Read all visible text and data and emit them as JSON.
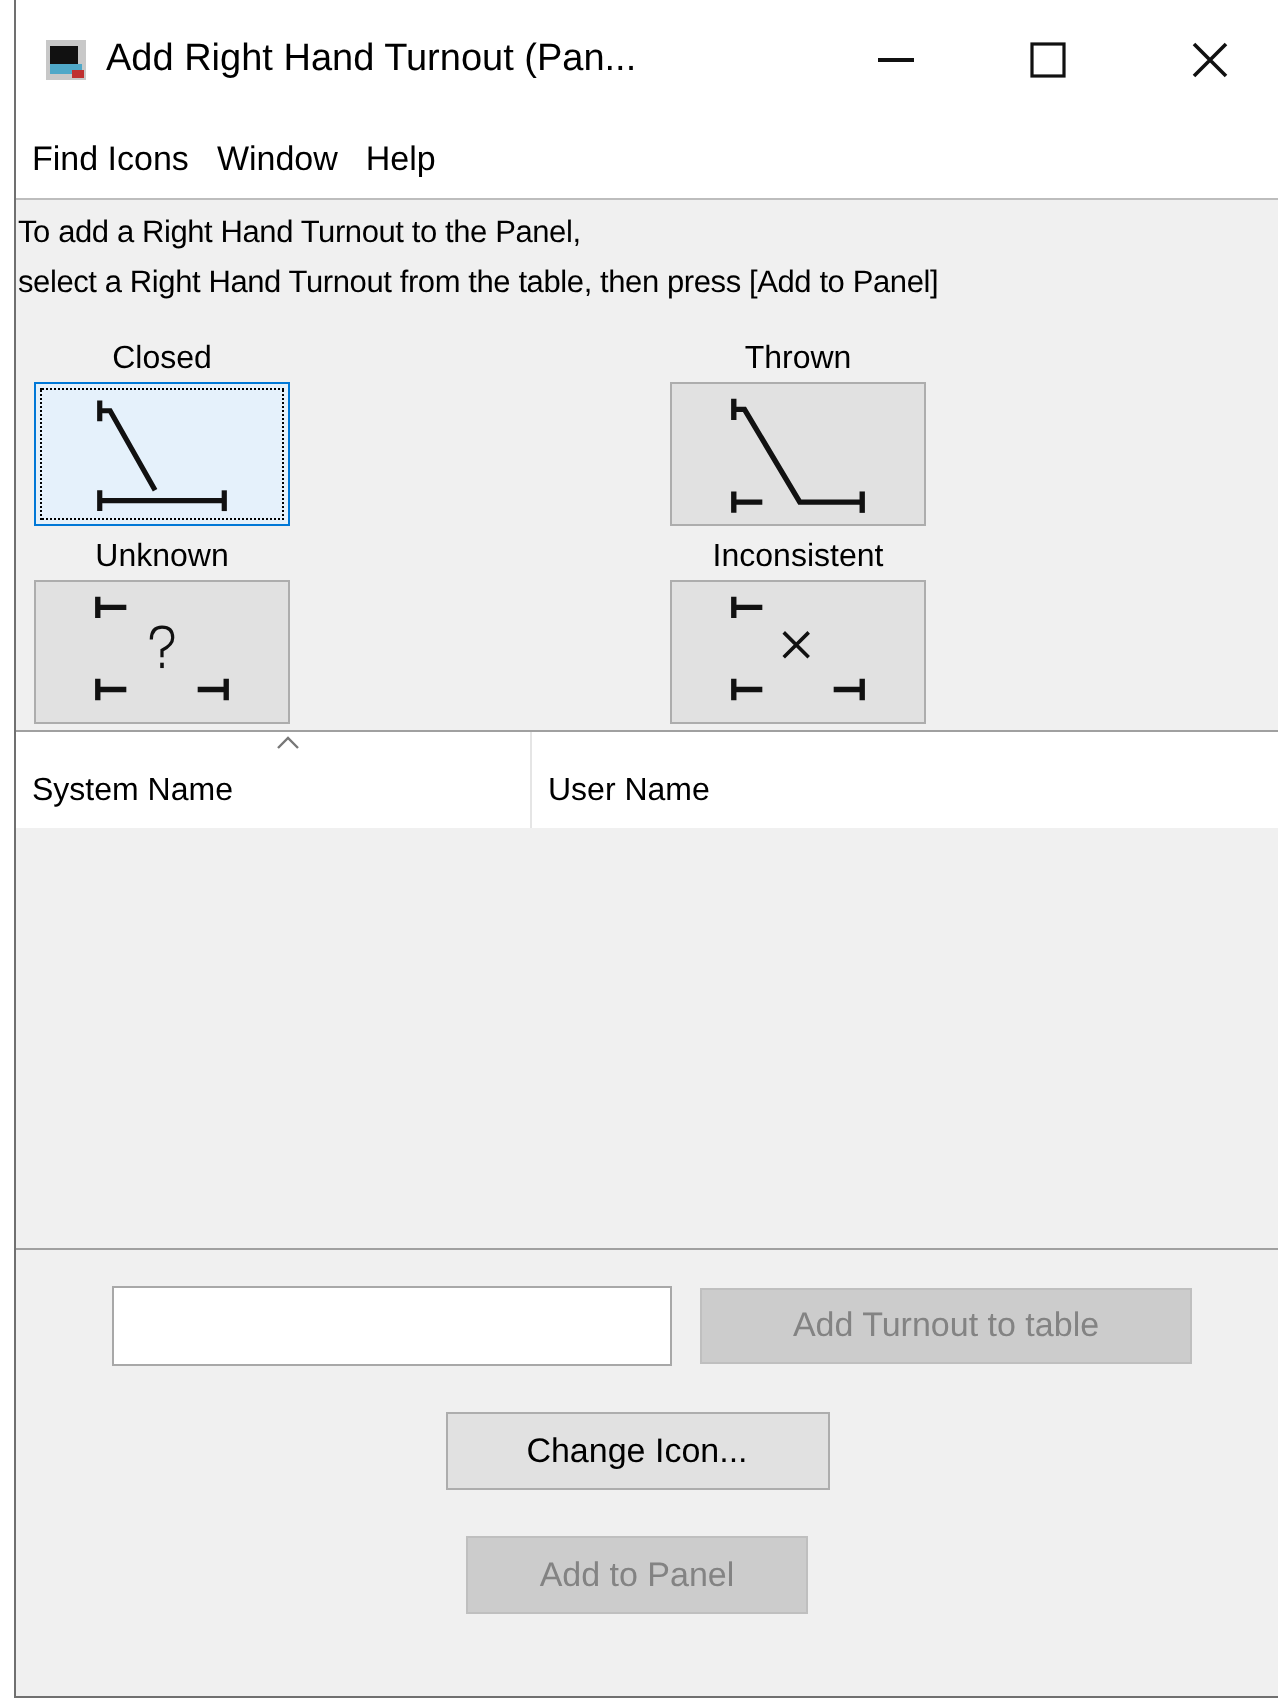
{
  "window": {
    "title": "Add Right Hand Turnout (Pan..."
  },
  "menu": [
    "Find Icons",
    "Window",
    "Help"
  ],
  "instructions": [
    "To add a Right Hand Turnout to the Panel,",
    "select a Right Hand Turnout from the table, then press [Add to Panel]"
  ],
  "icons": [
    {
      "label": "Closed",
      "kind": "closed",
      "selected": true
    },
    {
      "label": "Thrown",
      "kind": "thrown",
      "selected": false
    },
    {
      "label": "Unknown",
      "kind": "unknown",
      "selected": false
    },
    {
      "label": "Inconsistent",
      "kind": "inconsistent",
      "selected": false
    }
  ],
  "table": {
    "columns": [
      {
        "label": "System Name",
        "sorted": true
      },
      {
        "label": "User Name",
        "sorted": false
      }
    ]
  },
  "add_row": {
    "button": {
      "label": "Add Turnout to table",
      "disabled": true
    }
  },
  "buttons": [
    {
      "label": "Change Icon...",
      "disabled": false
    },
    {
      "label": "Add to Panel",
      "disabled": true
    }
  ]
}
